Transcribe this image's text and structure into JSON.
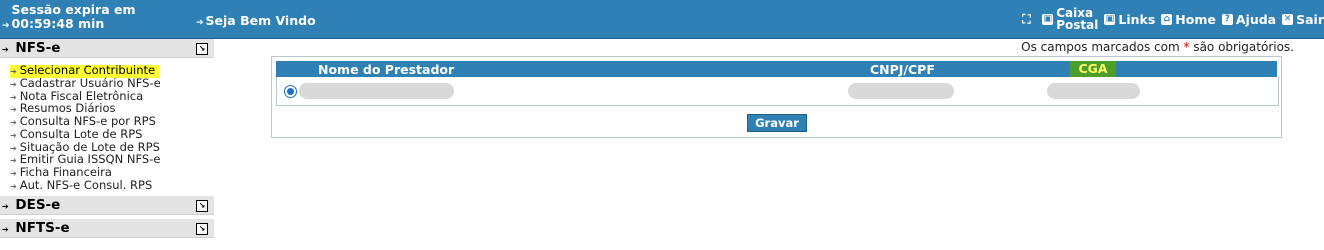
{
  "header": {
    "session": "Sessão expira em 00:59:48 min",
    "welcome": "Seja Bem Vindo",
    "nav": {
      "caixa_line1": "Caixa",
      "caixa_line2": "Postal",
      "links": "Links",
      "home": "Home",
      "ajuda": "Ajuda",
      "sair": "Sair"
    }
  },
  "sidebar": {
    "sections": [
      {
        "title": "NFS-e",
        "expanded": true,
        "items": [
          {
            "label": "Selecionar Contribuinte",
            "active": true
          },
          {
            "label": "Cadastrar Usuário NFS-e"
          },
          {
            "label": "Nota Fiscal Eletrônica"
          },
          {
            "label": "Resumos Diários"
          },
          {
            "label": "Consulta NFS-e por RPS"
          },
          {
            "label": "Consulta Lote de RPS"
          },
          {
            "label": "Situação de Lote de RPS"
          },
          {
            "label": "Emitir Guia ISSQN NFS-e"
          },
          {
            "label": "Ficha Financeira"
          },
          {
            "label": "Aut. NFS-e Consul. RPS"
          }
        ]
      },
      {
        "title": "DES-e",
        "expanded": false
      },
      {
        "title": "NFTS-e",
        "expanded": false
      }
    ]
  },
  "main": {
    "required_note_prefix": "Os campos marcados com",
    "required_mark": "*",
    "required_note_suffix": "são obrigatórios.",
    "table": {
      "columns": [
        "Nome do Prestador",
        "CNPJ/CPF",
        "CGA"
      ]
    },
    "save_label": "Gravar"
  },
  "colors": {
    "header_blue": "#2f80b5",
    "highlight_yellow": "#ffff33",
    "cga_green": "#4c9f2a"
  }
}
